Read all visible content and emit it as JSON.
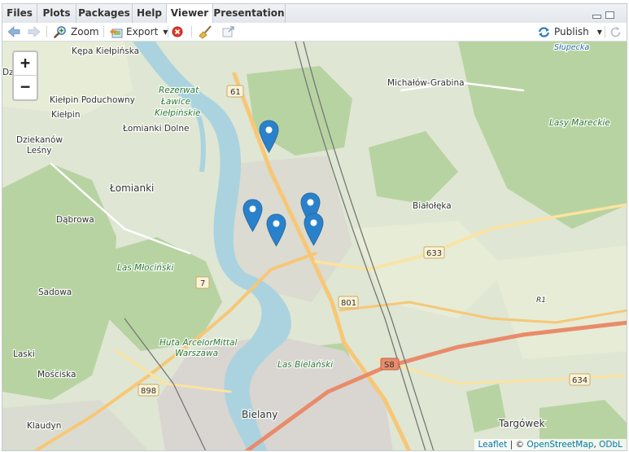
{
  "tabs": [
    {
      "label": "Files",
      "active": false
    },
    {
      "label": "Plots",
      "active": false
    },
    {
      "label": "Packages",
      "active": false
    },
    {
      "label": "Help",
      "active": false
    },
    {
      "label": "Viewer",
      "active": true
    },
    {
      "label": "Presentation",
      "active": false
    }
  ],
  "toolbar": {
    "zoom_label": "Zoom",
    "export_label": "Export",
    "publish_label": "Publish",
    "icons": [
      "back-arrow-icon",
      "forward-arrow-icon",
      "zoom-icon",
      "export-icon",
      "stop-icon",
      "broom-icon",
      "popout-icon",
      "publish-icon",
      "refresh-icon"
    ]
  },
  "map": {
    "zoom_in": "+",
    "zoom_out": "−",
    "place_labels": {
      "kepa": "Kępa Kiełpińska",
      "dziekanow": "Dziekanów",
      "lesny": "Leśny",
      "kielpin_poduchowny": "Kiełpin Poduchowny",
      "kielpin": "Kiełpin",
      "lomianki_dolne": "Łomianki Dolne",
      "lomianki": "Łomianki",
      "dabrowa": "Dąbrowa",
      "sadowa": "Sadowa",
      "laski": "Laski",
      "moscicka": "Mościska",
      "klaudyn": "Klaudyn",
      "michalow": "Michałów-Grabina",
      "bialoleka": "Białołęka",
      "bielany": "Bielany",
      "targowek": "Targówek",
      "dzi": "Dzi",
      "ka": "ka"
    },
    "nature_labels": {
      "rezerwat_1": "Rezerwat",
      "rezerwat_2": "Ławice",
      "rezerwat_3": "Kiełpińskie",
      "las_mlocinski": "Las Młociński",
      "las_bielanski": "Las Bielański",
      "huta_1": "Huta ArcelorMittal",
      "huta_2": "Warszawa",
      "las_marecki": "Lasy Mareckie",
      "slupecka": "Słupecka"
    },
    "road_shields": {
      "r61": "61",
      "r7": "7",
      "r801": "801",
      "r633": "633",
      "r898": "898",
      "rS8": "S8",
      "r634": "634",
      "rR1": "R1"
    },
    "marker_count": 5,
    "marker_color": "#2a81cb",
    "attribution": {
      "leaflet": "Leaflet",
      "sep": " | © ",
      "osm": "OpenStreetMap",
      "comma": ", ",
      "odbl": "ODbL"
    }
  }
}
